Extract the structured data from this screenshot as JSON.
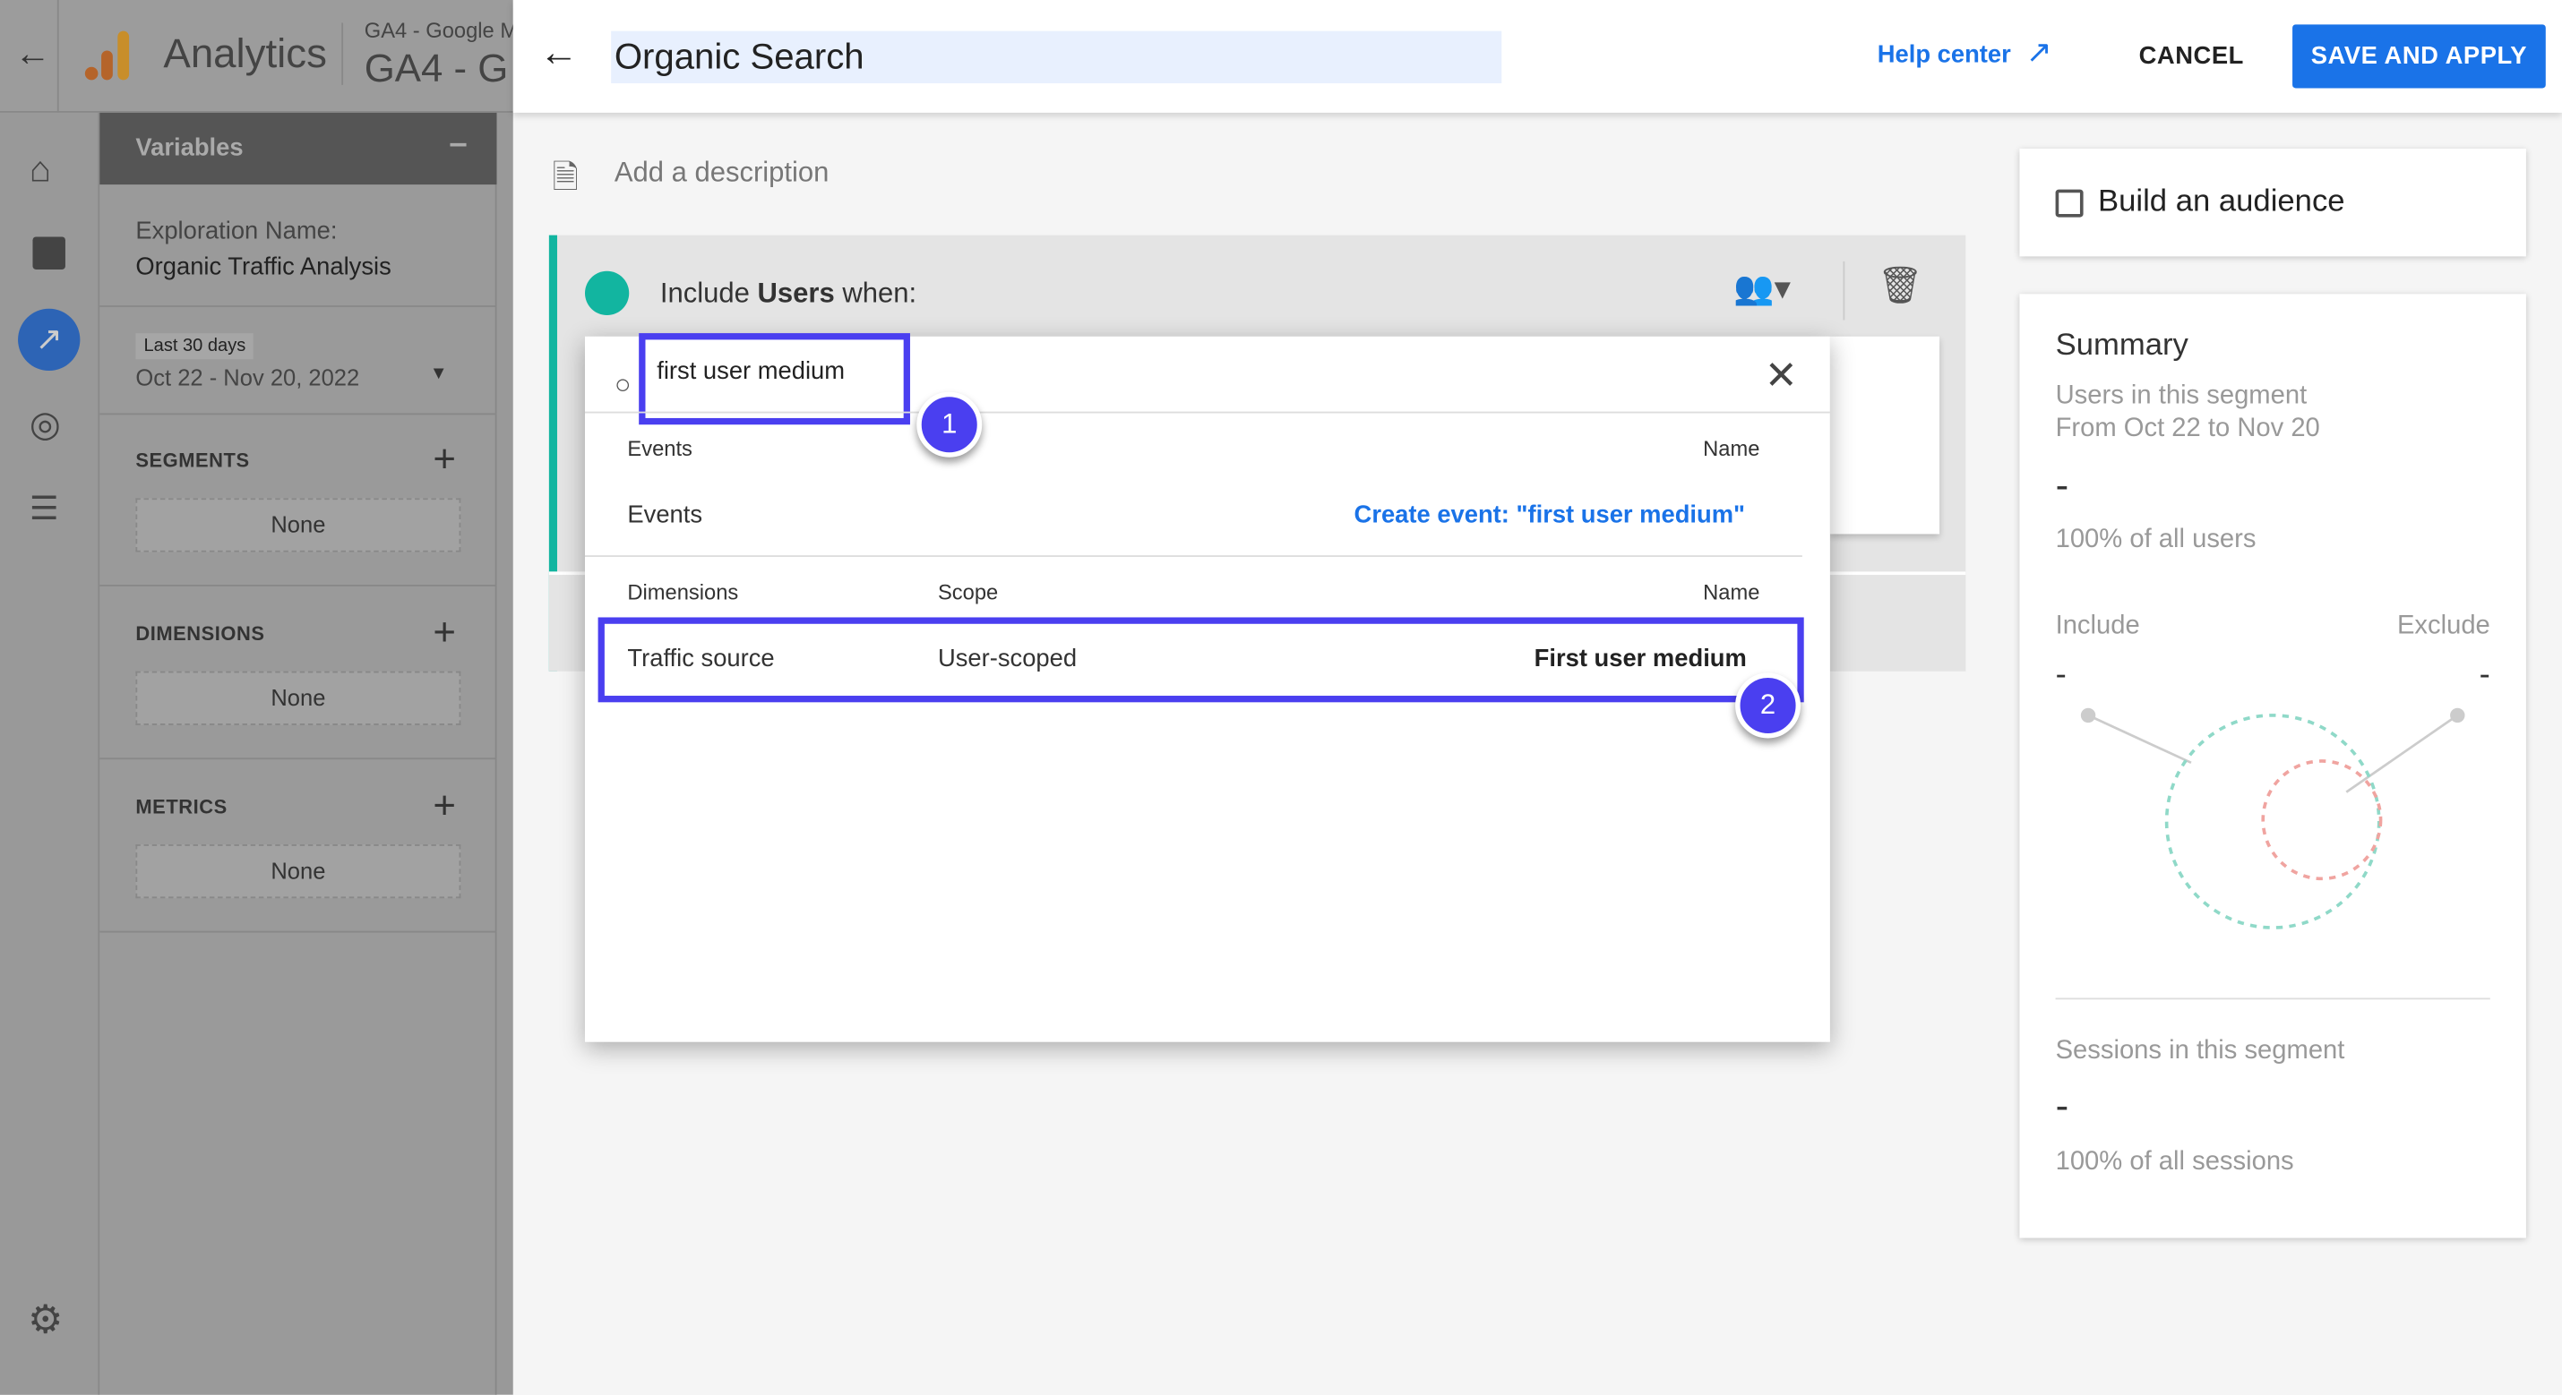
{
  "app": {
    "name": "Analytics",
    "account": "GA4 - Google M",
    "property": "GA4 - G"
  },
  "variables": {
    "title": "Variables",
    "exploration_label": "Exploration Name:",
    "exploration_name": "Organic Traffic Analysis",
    "date_chip": "Last 30 days",
    "date_range": "Oct 22 - Nov 20, 2022",
    "segments": "SEGMENTS",
    "dimensions": "DIMENSIONS",
    "metrics": "METRICS",
    "none": "None"
  },
  "header": {
    "title": "Organic Search",
    "help": "Help center",
    "cancel": "CANCEL",
    "save": "SAVE AND APPLY"
  },
  "description_placeholder": "Add a description",
  "segment": {
    "include": "Include",
    "users": "Users",
    "when": "when:"
  },
  "popup": {
    "search_value": "first user medium",
    "events_header": "Events",
    "name_header": "Name",
    "events_row": "Events",
    "create_event": "Create event: \"first user medium\"",
    "dimensions_header": "Dimensions",
    "scope_header": "Scope",
    "row": {
      "category": "Traffic source",
      "scope": "User-scoped",
      "name": "First user medium"
    }
  },
  "annotations": [
    "1",
    "2"
  ],
  "audience": {
    "label": "Build an audience",
    "checked": false
  },
  "summary": {
    "title": "Summary",
    "users_label": "Users in this segment",
    "range": "From Oct 22 to Nov 20",
    "users_value": "-",
    "users_pct": "100% of all users",
    "include": "Include",
    "exclude": "Exclude",
    "include_value": "-",
    "exclude_value": "-",
    "sessions_label": "Sessions in this segment",
    "sessions_value": "-",
    "sessions_pct": "100% of all sessions"
  },
  "colors": {
    "accent": "#1a73e8",
    "annotation": "#4a3ff0",
    "segment": "#12b5a0"
  }
}
